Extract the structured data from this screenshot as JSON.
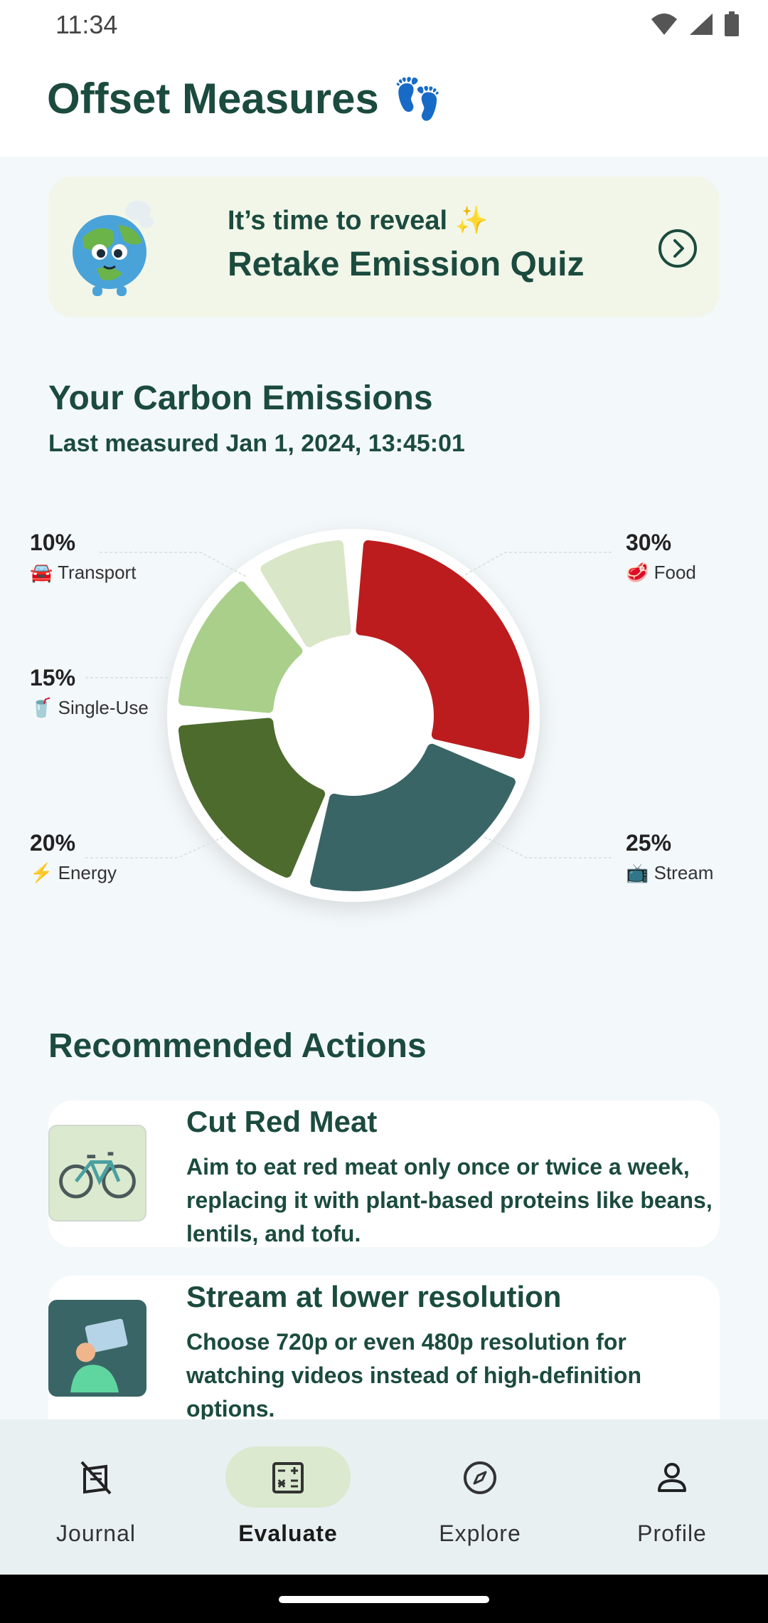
{
  "status_bar": {
    "time": "11:34"
  },
  "header": {
    "title": "Offset Measures",
    "emoji": "👣"
  },
  "quiz_card": {
    "kicker": "It’s time to reveal ✨",
    "title": "Retake Emission Quiz"
  },
  "emissions": {
    "title": "Your Carbon Emissions",
    "last_measured": "Last measured Jan 1, 2024, 13:45:01"
  },
  "chart_data": {
    "type": "pie",
    "categories": [
      "Food",
      "Stream",
      "Energy",
      "Single-Use",
      "Transport"
    ],
    "values": [
      30,
      25,
      20,
      15,
      10
    ],
    "labels": [
      "30%",
      "25%",
      "20%",
      "15%",
      "10%"
    ],
    "colors": [
      "#bc1c1e",
      "#3a6566",
      "#4d6b2d",
      "#a9cf8b",
      "#d9e6c7"
    ]
  },
  "recommended": {
    "title": "Recommended Actions",
    "items": [
      {
        "title": "Cut Red Meat",
        "description": "Aim to eat red meat only once or twice a week, replacing it with plant-based proteins like beans, lentils, and tofu."
      },
      {
        "title": "Stream at lower resolution",
        "description": "Choose 720p or even 480p resolution for watching videos instead of high-definition options."
      }
    ]
  },
  "nav": {
    "items": [
      {
        "label": "Journal",
        "icon": "journal-icon"
      },
      {
        "label": "Evaluate",
        "icon": "calculator-icon"
      },
      {
        "label": "Explore",
        "icon": "compass-icon"
      },
      {
        "label": "Profile",
        "icon": "person-icon"
      }
    ],
    "active": "Evaluate"
  }
}
